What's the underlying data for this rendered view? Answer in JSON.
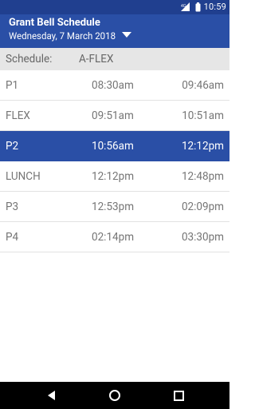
{
  "status": {
    "signal": "4G",
    "time": "10:59"
  },
  "app": {
    "title": "Grant Bell Schedule",
    "date": "Wednesday, 7 March 2018"
  },
  "schedule": {
    "label": "Schedule:",
    "value": "A-FLEX"
  },
  "periods": [
    {
      "name": "P1",
      "start": "08:30am",
      "end": "09:46am",
      "active": false
    },
    {
      "name": "FLEX",
      "start": "09:51am",
      "end": "10:51am",
      "active": false
    },
    {
      "name": "P2",
      "start": "10:56am",
      "end": "12:12pm",
      "active": true
    },
    {
      "name": "LUNCH",
      "start": "12:12pm",
      "end": "12:48pm",
      "active": false
    },
    {
      "name": "P3",
      "start": "12:53pm",
      "end": "02:09pm",
      "active": false
    },
    {
      "name": "P4",
      "start": "02:14pm",
      "end": "03:30pm",
      "active": false
    }
  ],
  "colors": {
    "status_bar": "#203f8f",
    "primary": "#2a4fa6",
    "schedule_bar": "#e6e6e6",
    "text_gray": "#757575"
  },
  "icons": [
    "signal-icon",
    "battery-icon",
    "dropdown-arrow-icon",
    "back-icon",
    "home-icon",
    "recents-icon"
  ]
}
